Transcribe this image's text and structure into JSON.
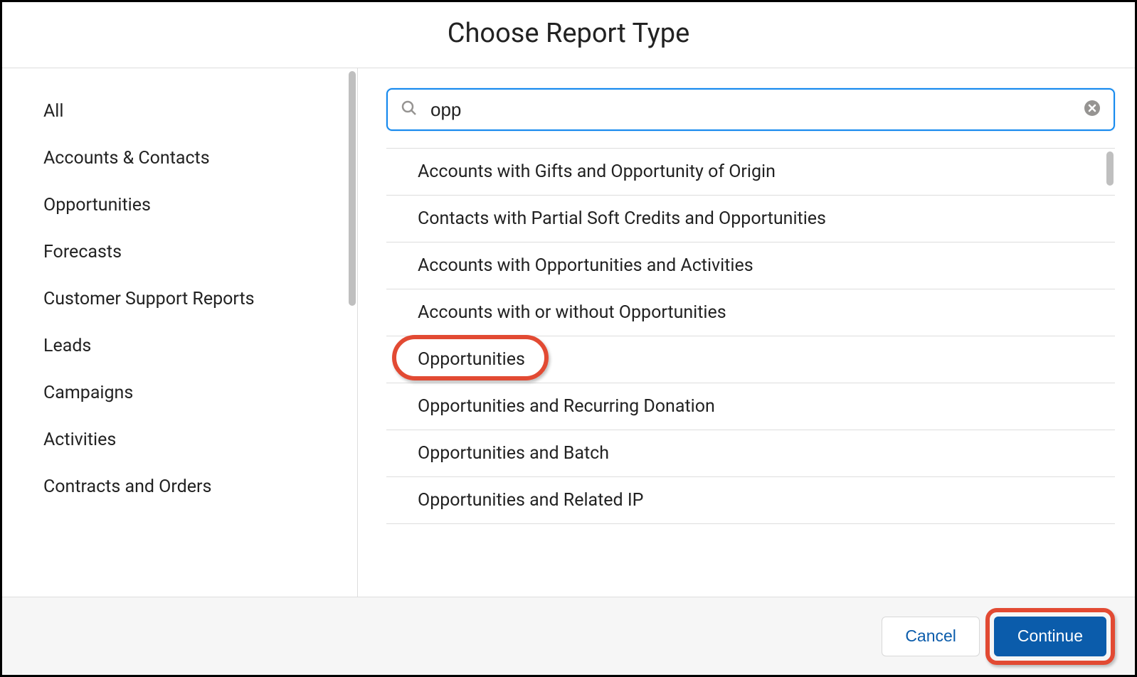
{
  "header": {
    "title": "Choose Report Type"
  },
  "sidebar": {
    "items": [
      {
        "label": "All"
      },
      {
        "label": "Accounts & Contacts"
      },
      {
        "label": "Opportunities"
      },
      {
        "label": "Forecasts"
      },
      {
        "label": "Customer Support Reports"
      },
      {
        "label": "Leads"
      },
      {
        "label": "Campaigns"
      },
      {
        "label": "Activities"
      },
      {
        "label": "Contracts and Orders"
      }
    ]
  },
  "search": {
    "value": "opp"
  },
  "results": {
    "items": [
      {
        "label": "Accounts with Gifts and Opportunity of Origin"
      },
      {
        "label": "Contacts with Partial Soft Credits and Opportunities"
      },
      {
        "label": "Accounts with Opportunities and Activities"
      },
      {
        "label": "Accounts with or without Opportunities"
      },
      {
        "label": "Opportunities"
      },
      {
        "label": "Opportunities and Recurring Donation"
      },
      {
        "label": "Opportunities and Batch"
      },
      {
        "label": "Opportunities and Related IP"
      }
    ]
  },
  "footer": {
    "cancel_label": "Cancel",
    "continue_label": "Continue"
  }
}
